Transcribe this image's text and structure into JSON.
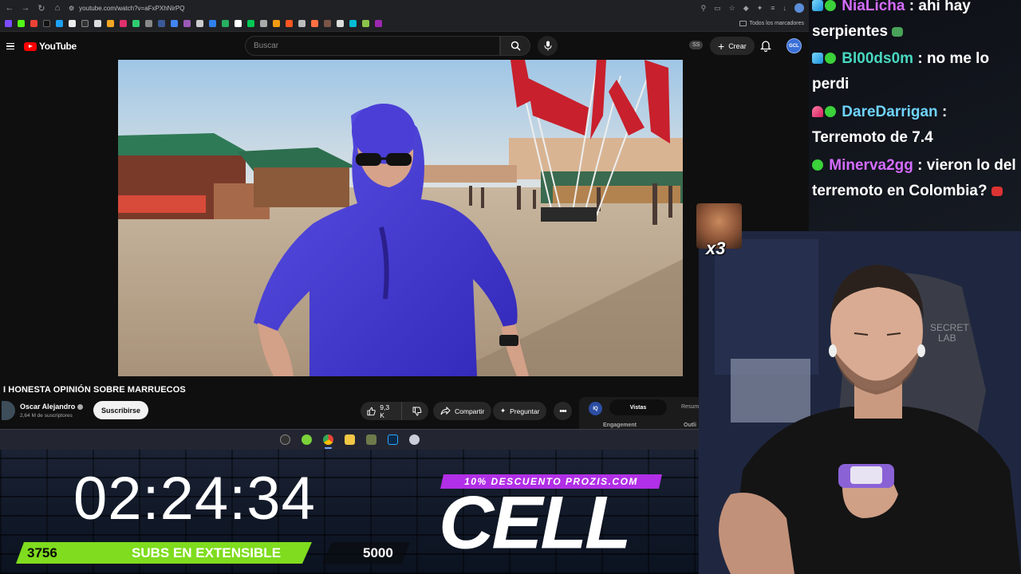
{
  "browser": {
    "url": "youtube.com/watch?v=aFxPXhNirPQ",
    "bookmarks_folder": "Todos los marcadores"
  },
  "youtube": {
    "logo_text": "YouTube",
    "search_placeholder": "Buscar",
    "ss_badge": "SS",
    "create_label": "Crear",
    "avatar_text": "GCL"
  },
  "video": {
    "title": "I HONESTA OPINIÓN SOBRE MARRUECOS",
    "channel_name": "Oscar Alejandro",
    "subscribers": "2,64 M de suscriptores",
    "subscribe_label": "Suscribirse",
    "likes": "9,3 K",
    "share_label": "Compartir",
    "ask_label": "Preguntar",
    "more_label": "•••"
  },
  "side_panel": {
    "badge": "IQ",
    "tab_active": "Vistas",
    "tab_other": "Resum",
    "label_left": "Engagement",
    "label_right": "Outli"
  },
  "overlay": {
    "timer": "02:24:34",
    "subs_current": "3756",
    "subs_label": "SUBS EN EXTENSIBLE",
    "subs_goal": "5000",
    "subs_progress": 0.7512,
    "promo": "10% DESCUENTO PROZIS.COM",
    "brand": "CELL"
  },
  "emote_counter": "x3",
  "chat": [
    {
      "user": "NiaLicha",
      "message": "ahi hay serpientes",
      "badge": "cube"
    },
    {
      "user": "Bl00ds0m",
      "message": "no me lo perdi",
      "badge": "cube"
    },
    {
      "user": "DareDarrigan",
      "message": "Terremoto de 7.4",
      "badge": "heart"
    },
    {
      "user": "Minerva2gg",
      "message": "vieron lo del terremoto en Colombia?",
      "badge": "sub"
    }
  ],
  "colors": {
    "youtube_red": "#ff0000",
    "subs_bar_green": "#7fdc1e",
    "promo_purple": "#b12fe6"
  }
}
